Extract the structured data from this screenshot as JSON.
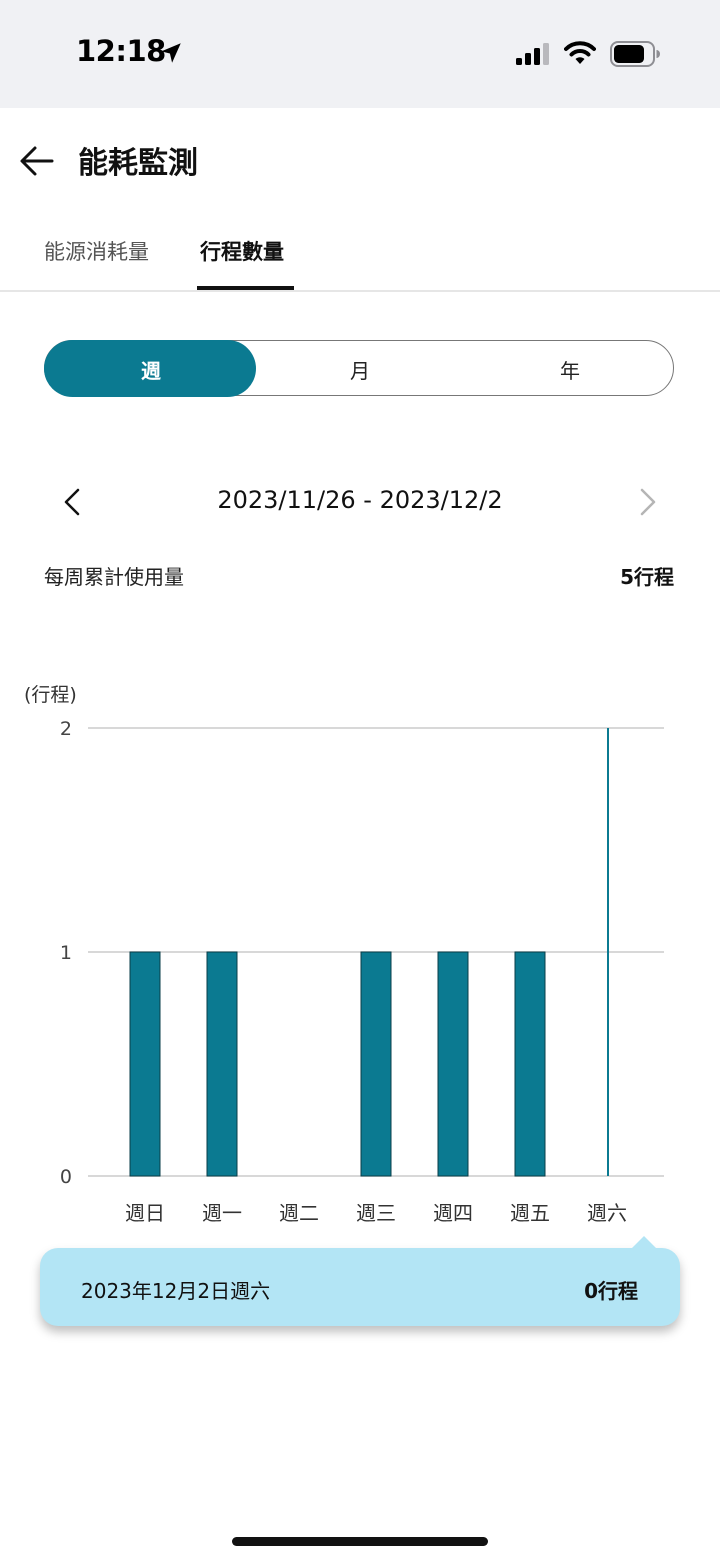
{
  "status_bar": {
    "time": "12:18",
    "icons": [
      "location-arrow-icon",
      "cellular-signal-icon",
      "wifi-icon",
      "battery-icon"
    ]
  },
  "header": {
    "title": "能耗監測",
    "back_icon": "arrow-left-icon"
  },
  "tabs": [
    {
      "label": "能源消耗量",
      "active": false
    },
    {
      "label": "行程數量",
      "active": true
    }
  ],
  "period_selector": {
    "options": [
      "週",
      "月",
      "年"
    ],
    "selected": "週"
  },
  "date_nav": {
    "range": "2023/11/26 - 2023/12/2",
    "prev_icon": "chevron-left-icon",
    "next_icon": "chevron-right-icon"
  },
  "summary": {
    "label": "每周累計使用量",
    "value": "5行程"
  },
  "colors": {
    "accent": "#0b7a91",
    "tooltip_bg": "#b3e5f5",
    "grid": "#cccccc"
  },
  "chart_data": {
    "type": "bar",
    "ylabel": "(行程)",
    "categories": [
      "週日",
      "週一",
      "週二",
      "週三",
      "週四",
      "週五",
      "週六"
    ],
    "values": [
      1,
      1,
      0,
      1,
      1,
      1,
      0
    ],
    "ylim": [
      0,
      2
    ],
    "yticks": [
      0,
      1,
      2
    ],
    "grid": true,
    "selected_index": 6
  },
  "tooltip": {
    "date": "2023年12月2日週六",
    "value": "0行程"
  }
}
